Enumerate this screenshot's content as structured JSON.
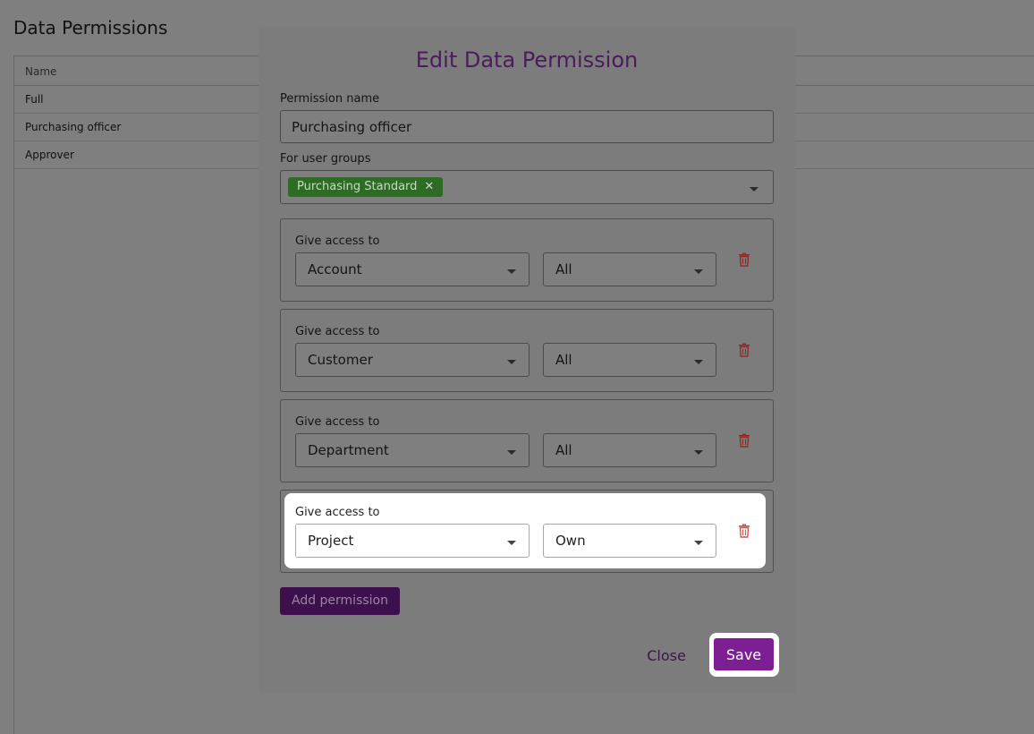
{
  "page": {
    "title": "Data Permissions",
    "table": {
      "header": "Name",
      "rows": [
        "Full",
        "Purchasing officer",
        "Approver"
      ]
    }
  },
  "modal": {
    "title": "Edit Data Permission",
    "permission_name_label": "Permission name",
    "permission_name_value": "Purchasing officer",
    "user_groups_label": "For user groups",
    "user_groups": [
      "Purchasing Standard"
    ],
    "chip_remove_glyph": "✕",
    "permissions": [
      {
        "label": "Give access to",
        "entity": "Account",
        "scope": "All"
      },
      {
        "label": "Give access to",
        "entity": "Customer",
        "scope": "All"
      },
      {
        "label": "Give access to",
        "entity": "Department",
        "scope": "All"
      },
      {
        "label": "Give access to",
        "entity": "Project",
        "scope": "Own"
      }
    ],
    "add_permission_label": "Add permission",
    "close_label": "Close",
    "save_label": "Save"
  },
  "icons": {
    "delete": "trash-icon",
    "dropdown": "chevron-down-icon",
    "remove_chip": "close-icon"
  },
  "colors": {
    "accent": "#7b1f92",
    "title": "#4a1c5c",
    "chip": "#2e6b25",
    "delete_icon": "#8f2c2c"
  }
}
